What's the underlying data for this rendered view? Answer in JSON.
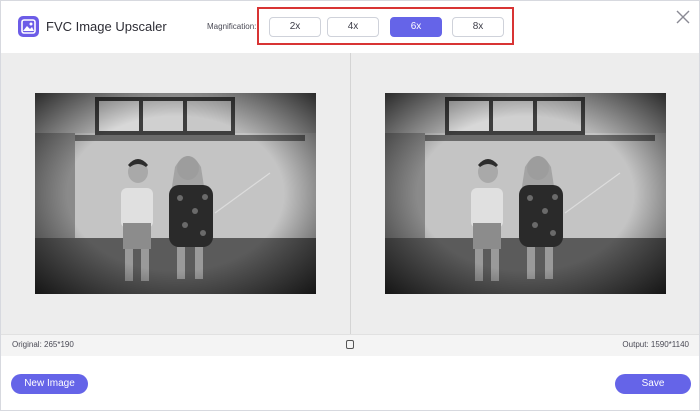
{
  "app": {
    "title": "FVC Image Upscaler",
    "accent_color": "#6564e8",
    "highlight_color": "#d83434"
  },
  "magnification": {
    "label": "Magnification:",
    "options": [
      "2x",
      "4x",
      "6x",
      "8x"
    ],
    "selected": "6x"
  },
  "images": {
    "original": {
      "description_icon": "photo-two-children-sitting"
    },
    "output": {
      "description_icon": "photo-two-children-sitting"
    }
  },
  "info": {
    "original": "Original: 265*190",
    "output": "Output: 1590*1140"
  },
  "actions": {
    "new_image": "New Image",
    "save": "Save"
  },
  "icons": {
    "logo": "image-upscaler-logo-icon",
    "close": "close-icon",
    "toggle": "compare-toggle-icon"
  }
}
